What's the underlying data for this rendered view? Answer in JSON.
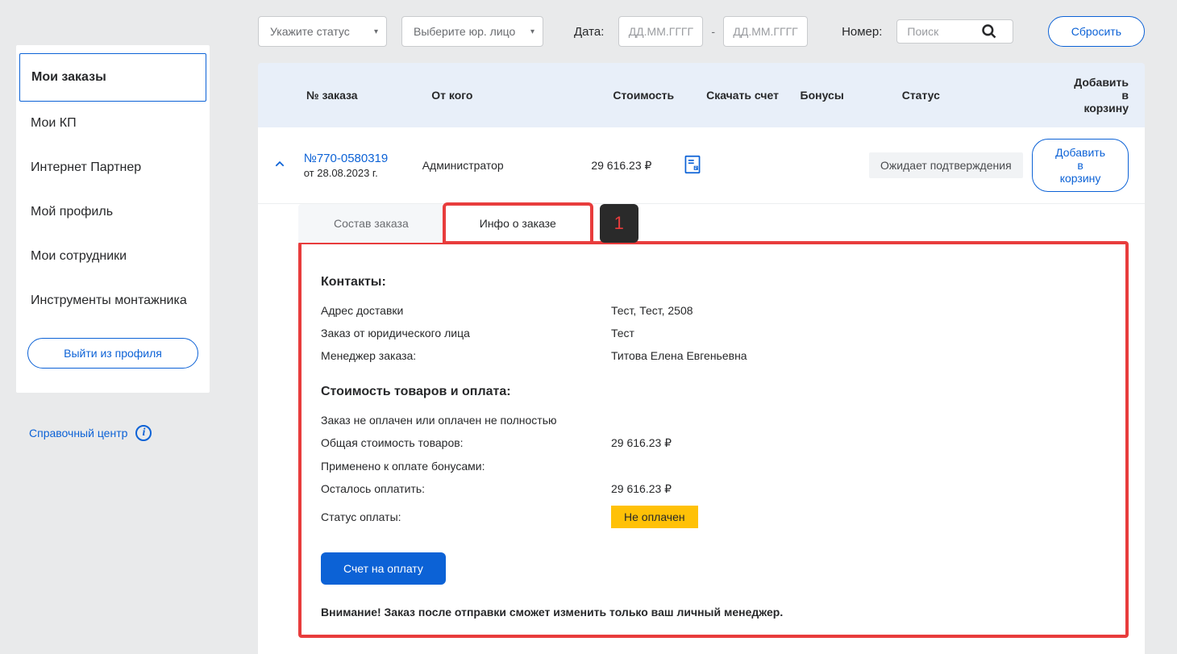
{
  "sidebar": {
    "items": [
      "Мои заказы",
      "Мои КП",
      "Интернет Партнер",
      "Мой профиль",
      "Мои сотрудники",
      "Инструменты монтажника"
    ],
    "active_index": 0,
    "logout": "Выйти из профиля",
    "help": "Справочный центр"
  },
  "filters": {
    "status_ph": "Укажите статус",
    "legal_ph": "Выберите юр. лицо",
    "date_label": "Дата:",
    "date_ph": "ДД.ММ.ГГГГ",
    "number_label": "Номер:",
    "search_ph": "Поиск",
    "reset": "Сбросить"
  },
  "table": {
    "headers": {
      "no": "№ заказа",
      "from": "От кого",
      "cost": "Стоимость",
      "bill": "Скачать счет",
      "bonus": "Бонусы",
      "status": "Статус",
      "add": "Добавить в корзину"
    },
    "row": {
      "order_no": "№770-0580319",
      "date": "от 28.08.2023 г.",
      "from": "Администратор",
      "cost": "29 616.23 ₽",
      "status": "Ожидает подтверждения",
      "add": "Добавить в корзину"
    }
  },
  "tabs": {
    "compose": "Состав заказа",
    "info": "Инфо о заказе"
  },
  "callout": "1",
  "details": {
    "contacts_h": "Контакты:",
    "addr_k": "Адрес доставки",
    "addr_v": "Тест, Тест, 2508",
    "legal_k": "Заказ от юридического лица",
    "legal_v": "Тест",
    "mgr_k": "Менеджер заказа:",
    "mgr_v": "Титова Елена Евгеньевна",
    "pay_h": "Стоимость товаров и оплата:",
    "pay_note": "Заказ не оплачен или оплачен не полностью",
    "total_k": "Общая стоимость товаров:",
    "total_v": "29 616.23 ₽",
    "bonus_k": "Применено к оплате бонусами:",
    "bonus_v": "",
    "left_k": "Осталось оплатить:",
    "left_v": "29 616.23 ₽",
    "paystatus_k": "Статус оплаты:",
    "paystatus_v": "Не оплачен",
    "invoice_btn": "Счет на оплату",
    "warning": "Внимание! Заказ после отправки сможет изменить только ваш личный менеджер."
  }
}
